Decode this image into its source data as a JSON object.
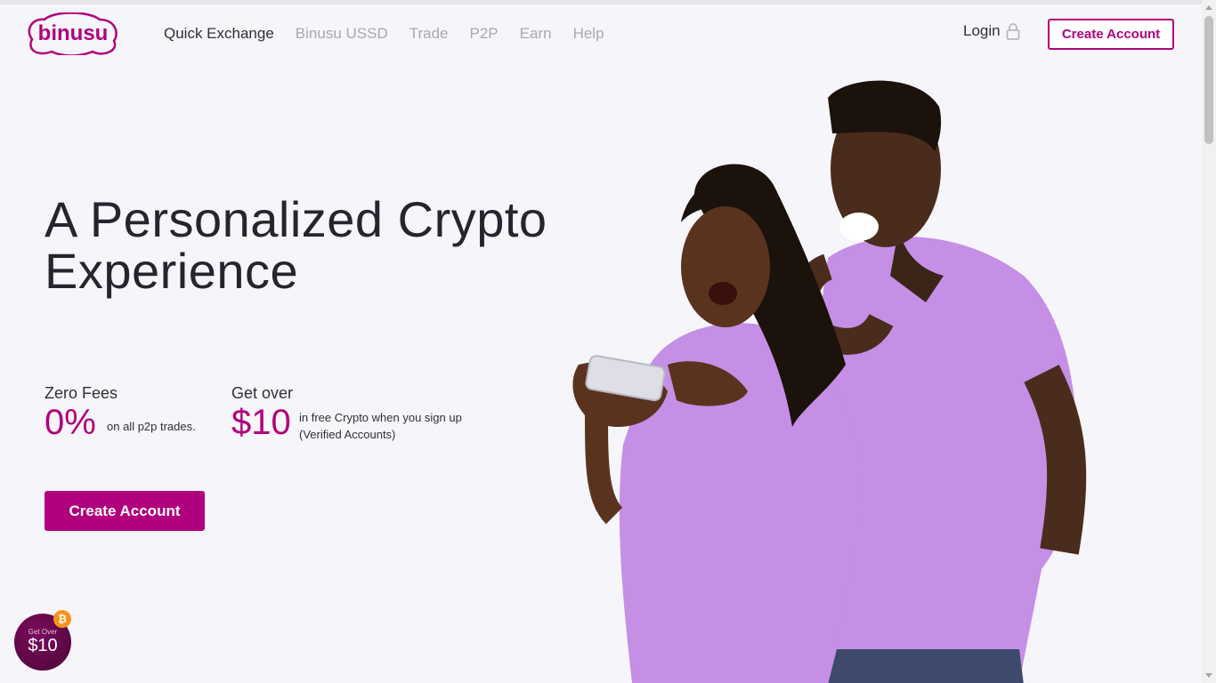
{
  "brand": {
    "logo_text": "binusu",
    "color": "#b0007e"
  },
  "nav": {
    "items": [
      {
        "label": "Quick Exchange",
        "active": true
      },
      {
        "label": "Binusu USSD",
        "active": false
      },
      {
        "label": "Trade",
        "active": false
      },
      {
        "label": "P2P",
        "active": false
      },
      {
        "label": "Earn",
        "active": false
      },
      {
        "label": "Help",
        "active": false
      }
    ],
    "login_label": "Login",
    "login_icon": "lock-icon",
    "create_account_label": "Create Account"
  },
  "hero": {
    "title_line1": "A Personalized Crypto",
    "title_line2": "Experience",
    "stats": [
      {
        "label": "Zero Fees",
        "value": "0%",
        "note_line1": "on all p2p trades.",
        "note_line2": ""
      },
      {
        "label": "Get over",
        "value": "$10",
        "note_line1": "in free Crypto when you sign up",
        "note_line2": "(Verified Accounts)"
      }
    ],
    "cta_label": "Create Account"
  },
  "floating_badge": {
    "small_text": "Get Over",
    "amount": "$10",
    "icon": "bitcoin-icon"
  },
  "colors": {
    "accent": "#b0007e",
    "background": "#f6f5f9",
    "shirt": "#c58fe6"
  }
}
